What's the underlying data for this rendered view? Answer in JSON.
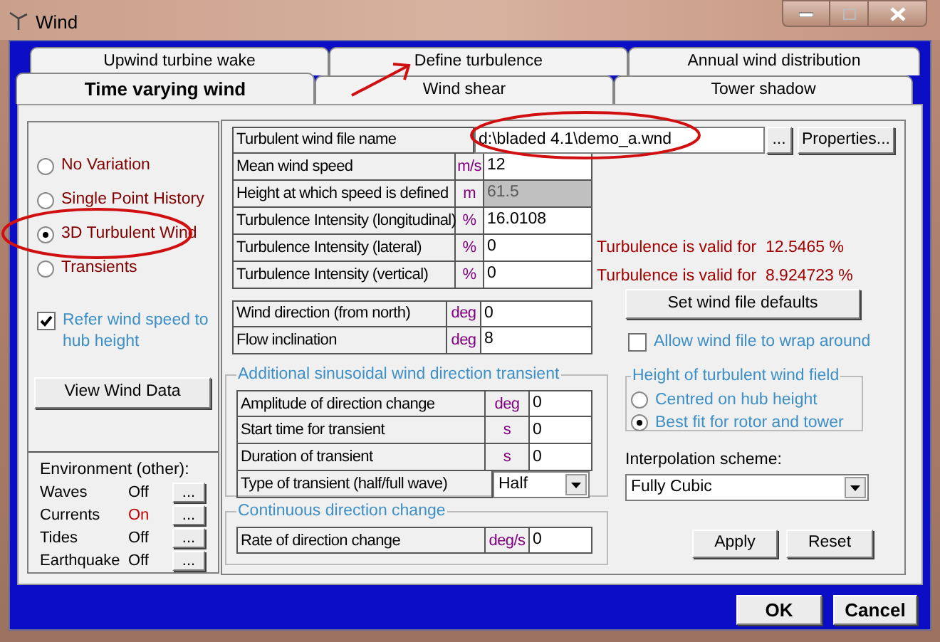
{
  "window": {
    "title": "Wind"
  },
  "tab_rows": [
    [
      {
        "label": "Upwind turbine wake",
        "selected": false
      },
      {
        "label": "Define turbulence",
        "selected": false
      },
      {
        "label": "Annual wind distribution",
        "selected": false
      }
    ],
    [
      {
        "label": "Time varying wind",
        "selected": true
      },
      {
        "label": "Wind shear",
        "selected": false
      },
      {
        "label": "Tower shadow",
        "selected": false
      }
    ]
  ],
  "variation_options": [
    {
      "label": "No Variation",
      "selected": false
    },
    {
      "label": "Single Point History",
      "selected": false
    },
    {
      "label": "3D Turbulent Wind",
      "selected": true
    },
    {
      "label": "Transients",
      "selected": false
    }
  ],
  "refer_checkbox": {
    "label": "Refer wind speed to hub height",
    "checked": true
  },
  "view_button": "View Wind Data",
  "environment": {
    "title": "Environment (other):",
    "items": [
      {
        "name": "Waves",
        "status": "Off",
        "on": false,
        "button": "..."
      },
      {
        "name": "Currents",
        "status": "On",
        "on": true,
        "button": "..."
      },
      {
        "name": "Tides",
        "status": "Off",
        "on": false,
        "button": "..."
      },
      {
        "name": "Earthquake",
        "status": "Off",
        "on": false,
        "button": "..."
      }
    ]
  },
  "file_field": {
    "label": "Turbulent wind file name",
    "value": "d:\\bladed 4.1\\demo_a.wnd",
    "browse_button": "...",
    "properties_button": "Properties..."
  },
  "parameters": [
    {
      "label": "Mean wind speed",
      "unit": "m/s",
      "value": "12",
      "disabled": false
    },
    {
      "label": "Height at which speed is defined",
      "unit": "m",
      "value": "61.5",
      "disabled": true
    },
    {
      "label": "Turbulence Intensity (longitudinal)",
      "unit": "%",
      "value": "16.0108",
      "disabled": false
    },
    {
      "label": "Turbulence Intensity (lateral)",
      "unit": "%",
      "value": "0",
      "disabled": false
    },
    {
      "label": "Turbulence Intensity (vertical)",
      "unit": "%",
      "value": "0",
      "disabled": false
    }
  ],
  "validity": [
    "Turbulence is valid for  12.5465 %",
    "Turbulence is valid for  8.924723 %"
  ],
  "direction": [
    {
      "label": "Wind direction (from north)",
      "unit": "deg",
      "value": "0"
    },
    {
      "label": "Flow inclination",
      "unit": "deg",
      "value": "8"
    }
  ],
  "transient": {
    "title": "Additional sinusoidal wind direction transient",
    "rows": [
      {
        "kind": "input",
        "label": "Amplitude of direction change",
        "unit": "deg",
        "value": "0"
      },
      {
        "kind": "input",
        "label": "Start time for transient",
        "unit": "s",
        "value": "0"
      },
      {
        "kind": "input",
        "label": "Duration of transient",
        "unit": "s",
        "value": "0"
      },
      {
        "kind": "select",
        "label": "Type of transient (half/full wave)",
        "value": "Half"
      }
    ]
  },
  "continuous": {
    "title": "Continuous direction change",
    "rows": [
      {
        "kind": "input",
        "label": "Rate of direction change",
        "unit": "deg/s",
        "value": "0"
      }
    ]
  },
  "defaults_button": "Set wind file defaults",
  "wrap_checkbox": {
    "label": "Allow wind file to wrap around",
    "checked": false
  },
  "height_group": {
    "title": "Height of turbulent wind field",
    "options": [
      {
        "label": "Centred on hub height",
        "selected": false
      },
      {
        "label": "Best fit for rotor and tower",
        "selected": true
      }
    ]
  },
  "interpolation": {
    "label": "Interpolation scheme:",
    "value": "Fully Cubic"
  },
  "apply_button": "Apply",
  "reset_button": "Reset",
  "ok_button": "OK",
  "cancel_button": "Cancel"
}
